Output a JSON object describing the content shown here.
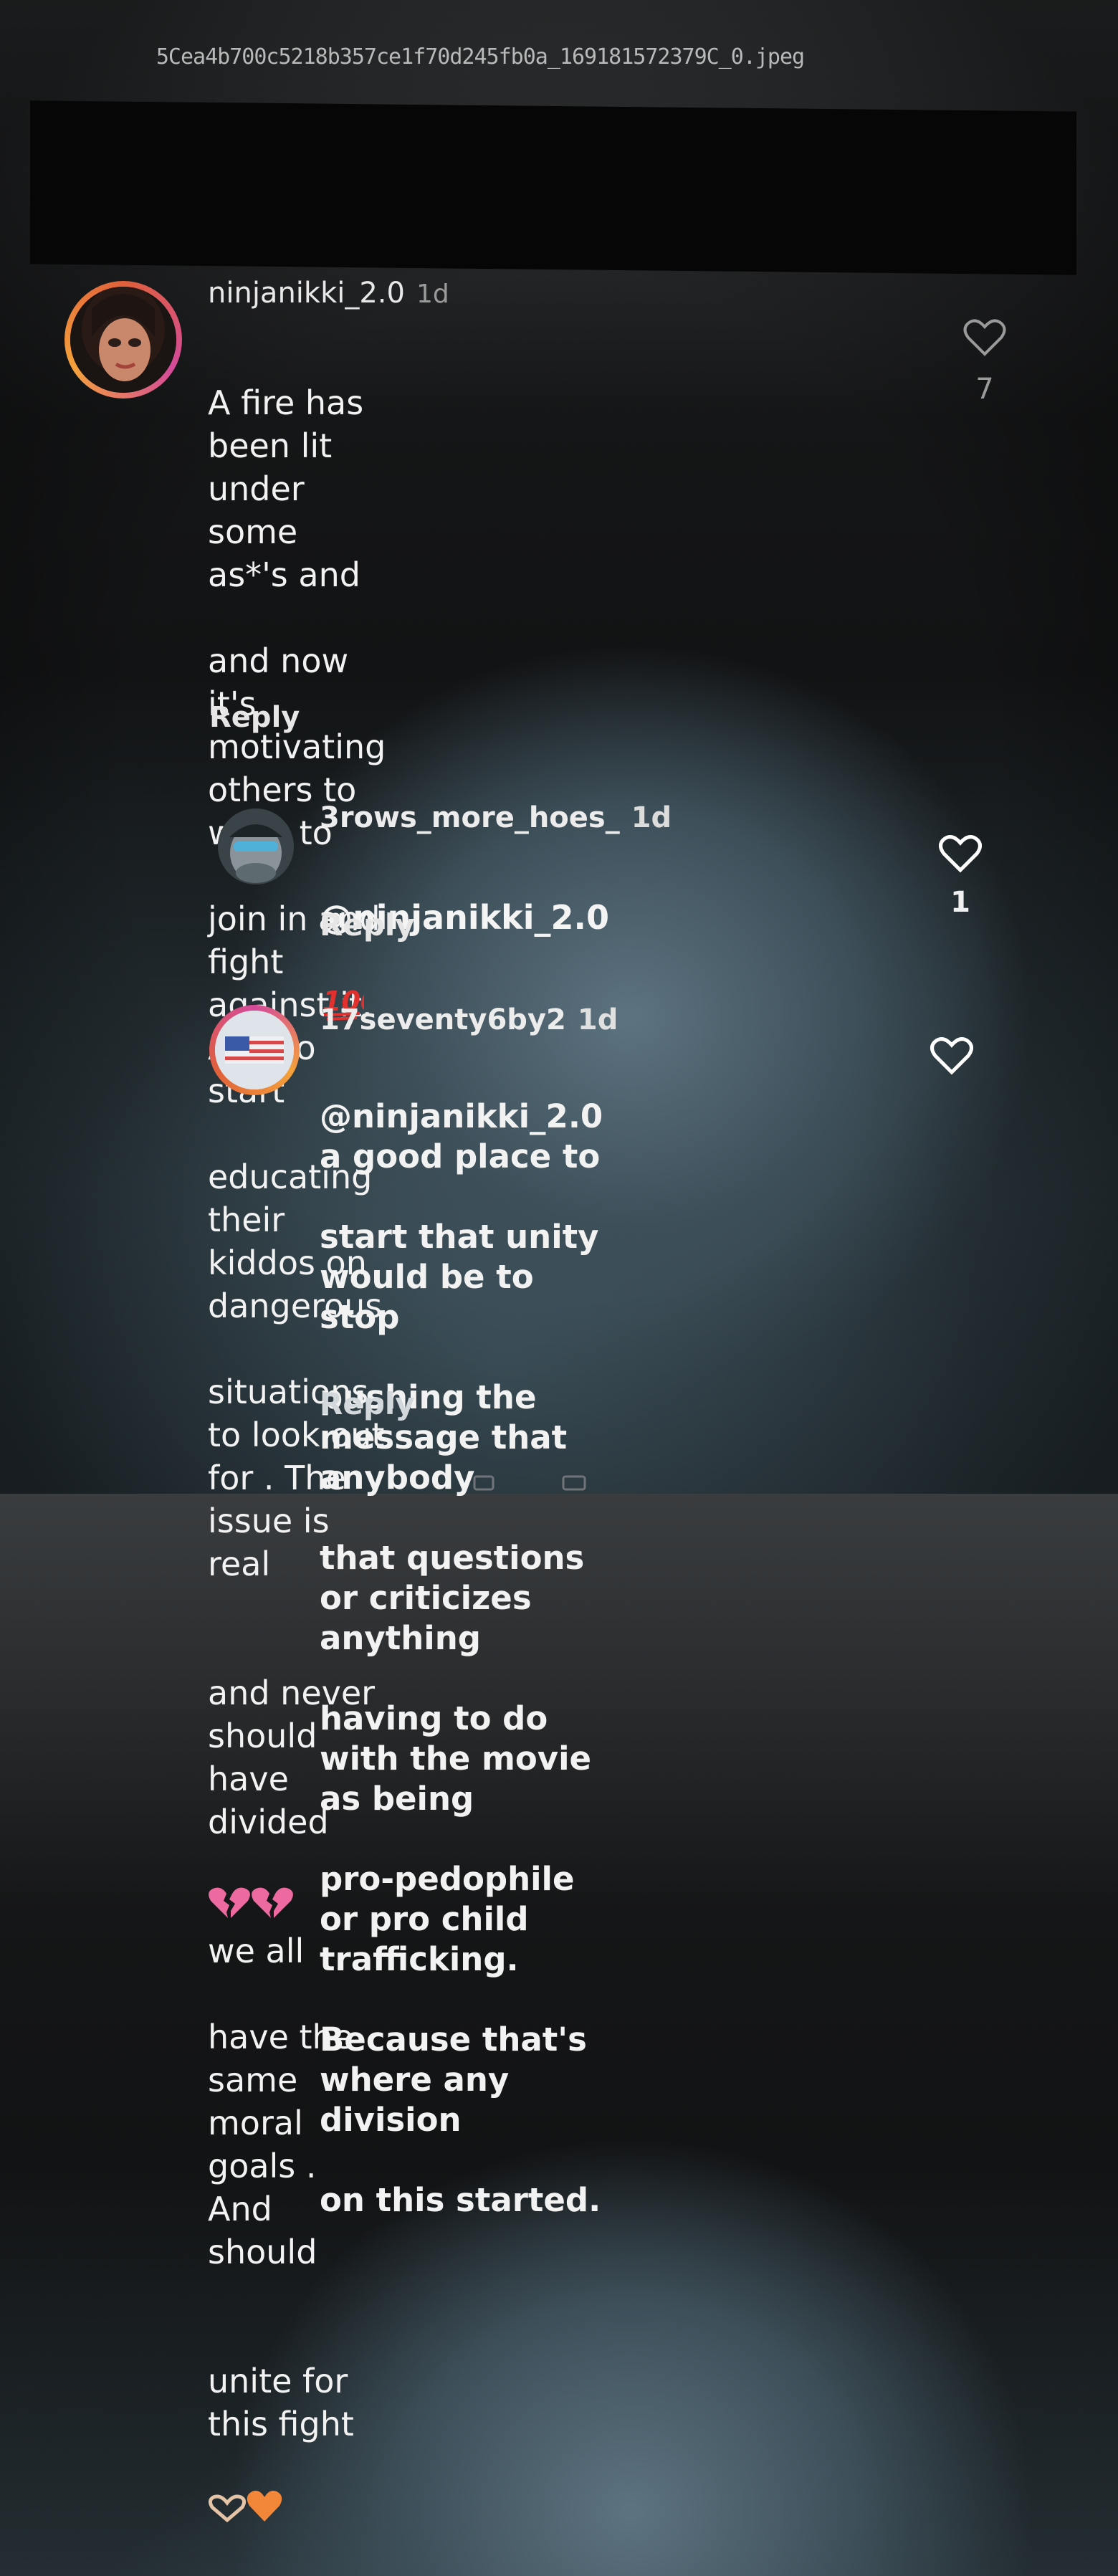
{
  "file": {
    "name": "5Cea4b700c5218b357ce1f70d245fb0a_169181572379C_0.jpeg"
  },
  "comments": [
    {
      "username": "ninjanikki_2.0",
      "time": "1d",
      "lines": [
        "A fire has been lit under some as*'s and",
        "and now it's motivating others to want to",
        "join in and fight against it. And to start",
        "educating their kiddos on dangerous",
        "situations to look out for . The issue is real",
        "and never should have divided",
        "we all",
        "have the same moral goals . And should",
        "unite for this fight"
      ],
      "reply_label": "Reply",
      "like_count": "7"
    },
    {
      "username": "3rows_more_hoes_",
      "time": "1d",
      "text": "@ninjanikki_2.0",
      "reply_label": "Reply",
      "like_count": "1"
    },
    {
      "username": "17seventy6by2",
      "time": "1d",
      "lines": [
        "@ninjanikki_2.0 a good place to",
        "start that unity would be to stop",
        "pushing the message that anybody",
        "that questions or criticizes anything",
        "having to do with the movie as being",
        "pro-pedophile or pro child trafficking.",
        "Because that's where any division",
        "on this started."
      ],
      "reply_label": "Reply"
    }
  ],
  "icons": {
    "like": "heart-outline-icon",
    "broken_heart": "broken-heart-emoji",
    "hands_heart": "heart-hands-emoji",
    "orange_heart": "orange-heart-emoji",
    "hundred": "hundred-points-emoji"
  },
  "colors": {
    "ring_orange": "#e0603a",
    "ring_pink": "#d44a9a",
    "broken_heart": "#ec6aa0",
    "orange_heart": "#f2873a",
    "hundred_red": "#e0312f"
  }
}
